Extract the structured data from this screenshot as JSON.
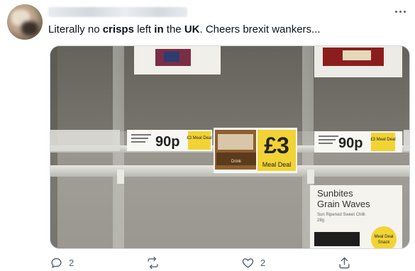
{
  "tweet": {
    "text_parts": [
      "Literally no ",
      "crisps",
      " left ",
      "in",
      " the ",
      "UK",
      ". Cheers brexit wankers..."
    ],
    "actions": {
      "reply_count": "2",
      "retweet_count": "",
      "like_count": "2"
    }
  },
  "photo": {
    "tags": {
      "left_price": "90p",
      "left_deal": "£3 Meal Deal",
      "center_price": "£3",
      "center_label": "Meal Deal",
      "center_drink": "Drink",
      "right_price": "90p",
      "right_deal": "£3 Meal Deal"
    },
    "product_card": {
      "title_line1": "Sunbites",
      "title_line2": "Grain Waves",
      "subtitle": "Sun Ripened Sweet Chilli",
      "weight": "28g",
      "badge_line1": "Meal Deal",
      "badge_line2": "Snack"
    }
  },
  "icons": {
    "reply": "reply-icon",
    "retweet": "retweet-icon",
    "like": "like-icon",
    "share": "share-icon",
    "more": "more-icon"
  },
  "colors": {
    "tag_yellow": "#f2d335",
    "text_primary": "#0f1419",
    "text_secondary": "#536471"
  }
}
